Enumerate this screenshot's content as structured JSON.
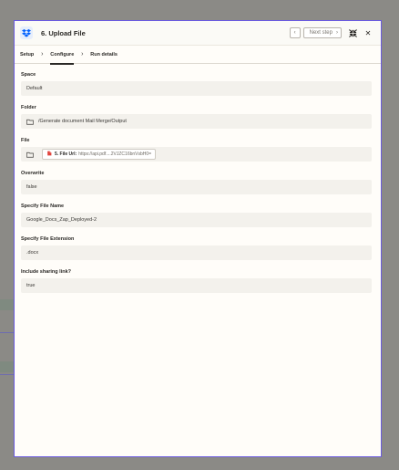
{
  "modal": {
    "title": "6. Upload File",
    "next_step_label": "Next step",
    "app_icon": "dropbox-icon"
  },
  "tabs": [
    {
      "label": "Setup",
      "active": false
    },
    {
      "label": "Configure",
      "active": true
    },
    {
      "label": "Run details",
      "active": false
    }
  ],
  "fields": {
    "space": {
      "label": "Space",
      "value": "Default"
    },
    "folder": {
      "label": "Folder",
      "value": "/Generate document Mail Merge/Output"
    },
    "file": {
      "label": "File",
      "pill_step": "5. File Url:",
      "pill_value": "https://api.pdf....2VJZC16bnVsbH0="
    },
    "overwrite": {
      "label": "Overwrite",
      "value": "false"
    },
    "file_name": {
      "label": "Specify File Name",
      "value": "Google_Docs_Zap_Deployed-2"
    },
    "file_extension": {
      "label": "Specify File Extension",
      "value": ".docx"
    },
    "sharing_link": {
      "label": "Include sharing link?",
      "value": "true"
    }
  },
  "colors": {
    "accent_border": "#6a5ae0",
    "panel_bg": "#fffdf9",
    "field_bg": "#f3f1ec",
    "dropbox_blue": "#0061fe",
    "pdf_red": "#e0413a"
  }
}
